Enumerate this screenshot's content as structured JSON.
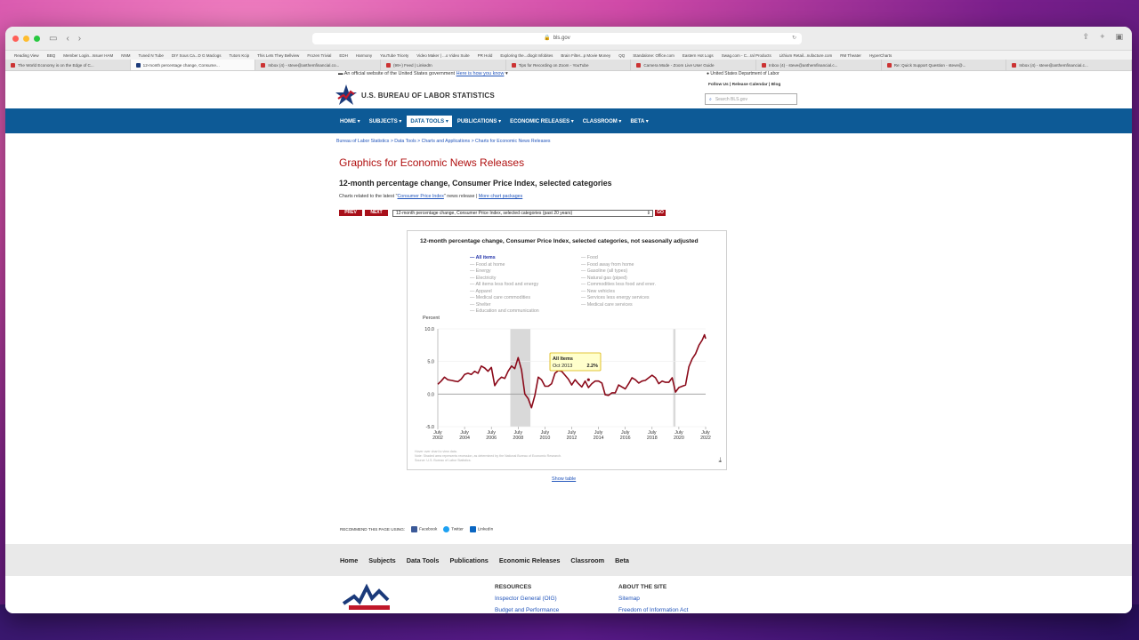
{
  "browser": {
    "url": "bls.gov",
    "bookmarks": [
      "Reading View",
      "BBQ",
      "Member Login...Issuer HAM",
      "NNM",
      "Tuned N Tube",
      "DIY Sous Ca...D G Maclogs",
      "Tutors Kcip",
      "This Lets They Bellview",
      "Frozen Trivial",
      "EDH",
      "Harmony",
      "YouTube Tricety",
      "Video Maker | ...o Video Suite",
      "PR Hold",
      "Exploring the...dlogit Infobites",
      "Brain Filter...p Movie Money",
      "QQ",
      "Standalone: Office.com",
      "Eastern Hot Logs",
      "Swag.com - C...ral Products",
      "Lithium Retail...nufacture.com",
      "RM Theater",
      "HyperCharts"
    ],
    "tabs": [
      {
        "label": "The World Economy is on the Edge of C..."
      },
      {
        "label": "12-month percentage change, Consume..."
      },
      {
        "label": "Inbox (4) - steve@anthemfinancial.co..."
      },
      {
        "label": "(99+) Feed | LinkedIn"
      },
      {
        "label": "Tips for Recording on Zoom - YouTube"
      },
      {
        "label": "Camera Mode - Zoom Live User Guide"
      },
      {
        "label": "Inbox (4) - steve@anthemfinancial.c..."
      },
      {
        "label": "Re: Quick Support Question - steve@..."
      },
      {
        "label": "Inbox (4) - steve@anthemfinancial.c..."
      }
    ]
  },
  "site": {
    "gov_banner": "An official website of the United States government",
    "gov_link": "Here is how you know",
    "dept": "United States Department of Labor",
    "logo_text": "U.S. BUREAU OF LABOR STATISTICS",
    "follow": "Follow Us  |  Release Calendar  |  Blog",
    "search_placeholder": "Search BLS.gov",
    "nav": [
      "HOME ▾",
      "SUBJECTS ▾",
      "DATA TOOLS ▾",
      "PUBLICATIONS ▾",
      "ECONOMIC RELEASES ▾",
      "CLASSROOM ▾",
      "BETA ▾"
    ],
    "breadcrumb": "Bureau of Labor Statistics > Data Tools > Charts and Applications > Charts for Economic News Releases"
  },
  "content": {
    "page_title": "Graphics for Economic News Releases",
    "subtitle": "12-month percentage change, Consumer Price Index, selected categories",
    "related_pre": "Charts related to the latest \"",
    "related_link": "Consumer Price Index",
    "related_post": "\" news release  |",
    "more_link": "More chart packages",
    "prev_label": "PREV",
    "next_label": "NEXT",
    "select_value": "12-month percentage change, Consumer Price Index, selected categories (past 20 years)",
    "go_label": "GO",
    "show_table": "Show table",
    "recommend": "RECOMMEND THIS PAGE USING:",
    "share": [
      "Facebook",
      "Twitter",
      "LinkedIn"
    ]
  },
  "chart": {
    "title": "12-month percentage change, Consumer Price Index, selected categories, not seasonally adjusted",
    "legend_left": [
      "All items",
      "Food at home",
      "Energy",
      "Electricity",
      "All items less food and energy",
      "Apparel",
      "Medical care commodities",
      "Shelter",
      "Education and communication"
    ],
    "legend_right": [
      "Food",
      "Food away from home",
      "Gasoline (all types)",
      "Natural gas (piped)",
      "Commodities less food and ener.",
      "New vehicles",
      "Services less energy services",
      "Medical care services"
    ],
    "ylabel": "Percent",
    "tooltip_series": "All Items",
    "tooltip_date": "Oct 2013",
    "tooltip_value": "2.2%",
    "source_lines": [
      "Hover over chart to view data.",
      "Note: Shaded area represents recession, as determined by the National Bureau of Economic Research.",
      "Source: U.S. Bureau of Labor Statistics."
    ],
    "accent_color": "#8b0a1a"
  },
  "chart_data": {
    "type": "line",
    "title": "12-month percentage change, Consumer Price Index, selected categories, not seasonally adjusted",
    "ylabel": "Percent",
    "ylim": [
      -5.0,
      10.0
    ],
    "yticks": [
      "10.0",
      "5.0",
      "0.0",
      "-5.0"
    ],
    "xticks": [
      [
        "July",
        "2002"
      ],
      [
        "July",
        "2004"
      ],
      [
        "July",
        "2006"
      ],
      [
        "July",
        "2008"
      ],
      [
        "July",
        "2010"
      ],
      [
        "July",
        "2012"
      ],
      [
        "July",
        "2014"
      ],
      [
        "July",
        "2016"
      ],
      [
        "July",
        "2018"
      ],
      [
        "July",
        "2020"
      ],
      [
        "July",
        "2022"
      ]
    ],
    "recessions": [
      [
        "2007-12",
        "2009-06"
      ],
      [
        "2020-02",
        "2020-04"
      ]
    ],
    "series": [
      {
        "name": "All items",
        "x": [
          "2002-07",
          "2002-10",
          "2003-01",
          "2003-04",
          "2003-07",
          "2003-10",
          "2004-01",
          "2004-04",
          "2004-07",
          "2004-10",
          "2005-01",
          "2005-04",
          "2005-07",
          "2005-10",
          "2006-01",
          "2006-04",
          "2006-07",
          "2006-10",
          "2007-01",
          "2007-04",
          "2007-07",
          "2007-10",
          "2008-01",
          "2008-04",
          "2008-07",
          "2008-10",
          "2009-01",
          "2009-04",
          "2009-07",
          "2009-10",
          "2010-01",
          "2010-04",
          "2010-07",
          "2010-10",
          "2011-01",
          "2011-04",
          "2011-07",
          "2011-10",
          "2012-01",
          "2012-04",
          "2012-07",
          "2012-10",
          "2013-01",
          "2013-04",
          "2013-07",
          "2013-10",
          "2014-01",
          "2014-04",
          "2014-07",
          "2014-10",
          "2015-01",
          "2015-04",
          "2015-07",
          "2015-10",
          "2016-01",
          "2016-04",
          "2016-07",
          "2016-10",
          "2017-01",
          "2017-04",
          "2017-07",
          "2017-10",
          "2018-01",
          "2018-04",
          "2018-07",
          "2018-10",
          "2019-01",
          "2019-04",
          "2019-07",
          "2019-10",
          "2020-01",
          "2020-04",
          "2020-07",
          "2020-10",
          "2021-01",
          "2021-04",
          "2021-07",
          "2021-10",
          "2022-01",
          "2022-04",
          "2022-06",
          "2022-07"
        ],
        "y": [
          1.5,
          2.0,
          2.6,
          2.2,
          2.1,
          2.0,
          1.9,
          2.3,
          3.0,
          3.2,
          3.0,
          3.5,
          3.2,
          4.3,
          4.0,
          3.5,
          4.1,
          1.3,
          2.1,
          2.6,
          2.4,
          3.5,
          4.3,
          3.9,
          5.6,
          3.7,
          0.0,
          -0.7,
          -2.1,
          -0.2,
          2.6,
          2.2,
          1.2,
          1.2,
          1.6,
          3.2,
          3.6,
          3.5,
          2.9,
          2.3,
          1.4,
          2.2,
          1.6,
          1.1,
          2.0,
          1.0,
          1.6,
          2.0,
          2.0,
          1.7,
          -0.1,
          -0.2,
          0.2,
          0.2,
          1.4,
          1.1,
          0.8,
          1.6,
          2.5,
          2.2,
          1.7,
          2.0,
          2.1,
          2.5,
          2.9,
          2.5,
          1.6,
          2.0,
          1.8,
          1.8,
          2.5,
          0.3,
          1.0,
          1.2,
          1.4,
          4.2,
          5.4,
          6.2,
          7.5,
          8.3,
          9.1,
          8.5
        ]
      }
    ]
  }
}
